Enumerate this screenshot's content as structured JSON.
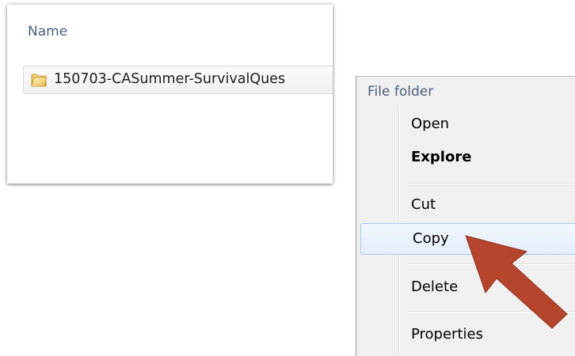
{
  "explorer": {
    "column_header": "Name",
    "file": {
      "icon": "folder-icon",
      "name": "150703-CASummer-SurvivalQues"
    }
  },
  "context_menu": {
    "header": "File folder",
    "items": [
      {
        "label": "Open",
        "bold": false,
        "highlighted": false
      },
      {
        "label": "Explore",
        "bold": true,
        "highlighted": false
      },
      {
        "label": "Cut",
        "bold": false,
        "highlighted": false
      },
      {
        "label": "Copy",
        "bold": false,
        "highlighted": true
      },
      {
        "label": "Delete",
        "bold": false,
        "highlighted": false
      },
      {
        "label": "Properties",
        "bold": false,
        "highlighted": false
      }
    ]
  },
  "annotation": {
    "arrow_color": "#b5452c",
    "points_to": "Copy"
  }
}
